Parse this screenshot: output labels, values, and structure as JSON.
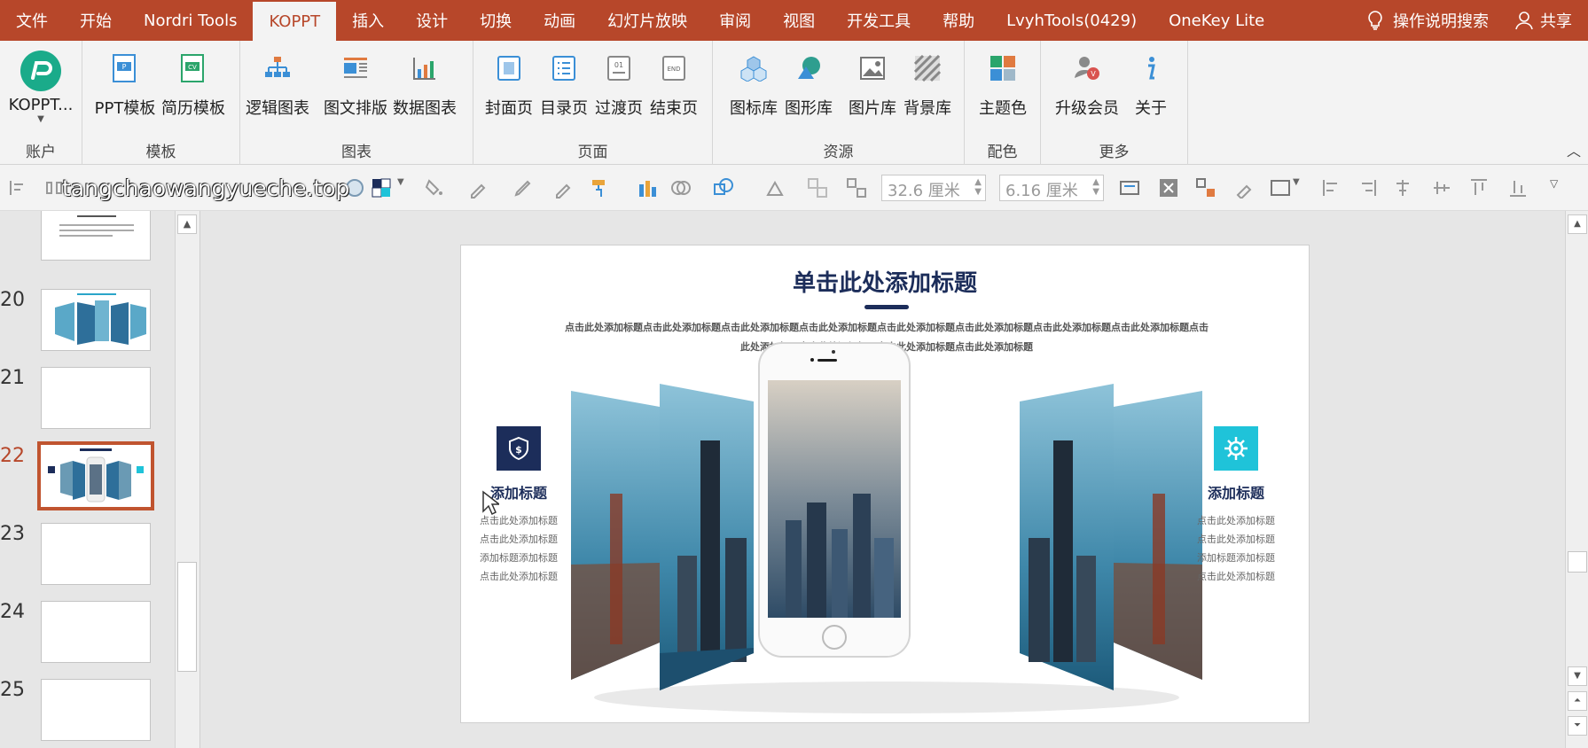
{
  "tabs": [
    {
      "label": "文件",
      "active": false
    },
    {
      "label": "开始",
      "active": false
    },
    {
      "label": "Nordri Tools",
      "active": false
    },
    {
      "label": "KOPPT",
      "active": true
    },
    {
      "label": "插入",
      "active": false
    },
    {
      "label": "设计",
      "active": false
    },
    {
      "label": "切换",
      "active": false
    },
    {
      "label": "动画",
      "active": false
    },
    {
      "label": "幻灯片放映",
      "active": false
    },
    {
      "label": "审阅",
      "active": false
    },
    {
      "label": "视图",
      "active": false
    },
    {
      "label": "开发工具",
      "active": false
    },
    {
      "label": "帮助",
      "active": false
    },
    {
      "label": "LvyhTools(0429)",
      "active": false
    },
    {
      "label": "OneKey Lite",
      "active": false
    }
  ],
  "tell_me": "操作说明搜索",
  "share": "共享",
  "ribbon": {
    "account": {
      "label": "账户",
      "btn": "KOPPT..."
    },
    "template": {
      "label": "模板",
      "btns": [
        "PPT模板",
        "简历模板"
      ]
    },
    "chart": {
      "label": "图表",
      "btns": [
        "逻辑图表",
        "图文排版",
        "数据图表"
      ]
    },
    "page": {
      "label": "页面",
      "btns": [
        "封面页",
        "目录页",
        "过渡页",
        "结束页"
      ]
    },
    "resource": {
      "label": "资源",
      "btns": [
        "图标库",
        "图形库",
        "图片库",
        "背景库"
      ]
    },
    "color": {
      "label": "配色",
      "btns": [
        "主题色"
      ]
    },
    "more": {
      "label": "更多",
      "btns": [
        "升级会员",
        "关于"
      ]
    }
  },
  "toolbar": {
    "watermark": "tangchaowangyueche.top",
    "height_value": "32.6 厘米",
    "width_value": "6.16 厘米"
  },
  "slides": [
    {
      "num": "20"
    },
    {
      "num": "21"
    },
    {
      "num": "22",
      "active": true
    },
    {
      "num": "23"
    },
    {
      "num": "24"
    },
    {
      "num": "25"
    }
  ],
  "slide": {
    "title": "单击此处添加标题",
    "subtitle_line1": "点击此处添加标题点击此处添加标题点击此处添加标题点击此处添加标题点击此处添加标题点击此处添加标题点击此处添加标题点击此处添加标题点击",
    "subtitle_line2": "此处添加标题点击此处添加标题点击此处添加标题点击此处添加标题",
    "left_feature": {
      "title": "添加标题",
      "lines": [
        "点击此处添加标题",
        "点击此处添加标题",
        "添加标题添加标题",
        "点击此处添加标题"
      ],
      "color": "#1c2d5a"
    },
    "right_feature": {
      "title": "添加标题",
      "lines": [
        "点击此处添加标题",
        "点击此处添加标题",
        "添加标题添加标题",
        "点击此处添加标题"
      ],
      "color": "#1fc3d9"
    }
  },
  "colors": {
    "accent": "#b7472a",
    "navy": "#1c2d5a",
    "cyan": "#1fc3d9"
  }
}
